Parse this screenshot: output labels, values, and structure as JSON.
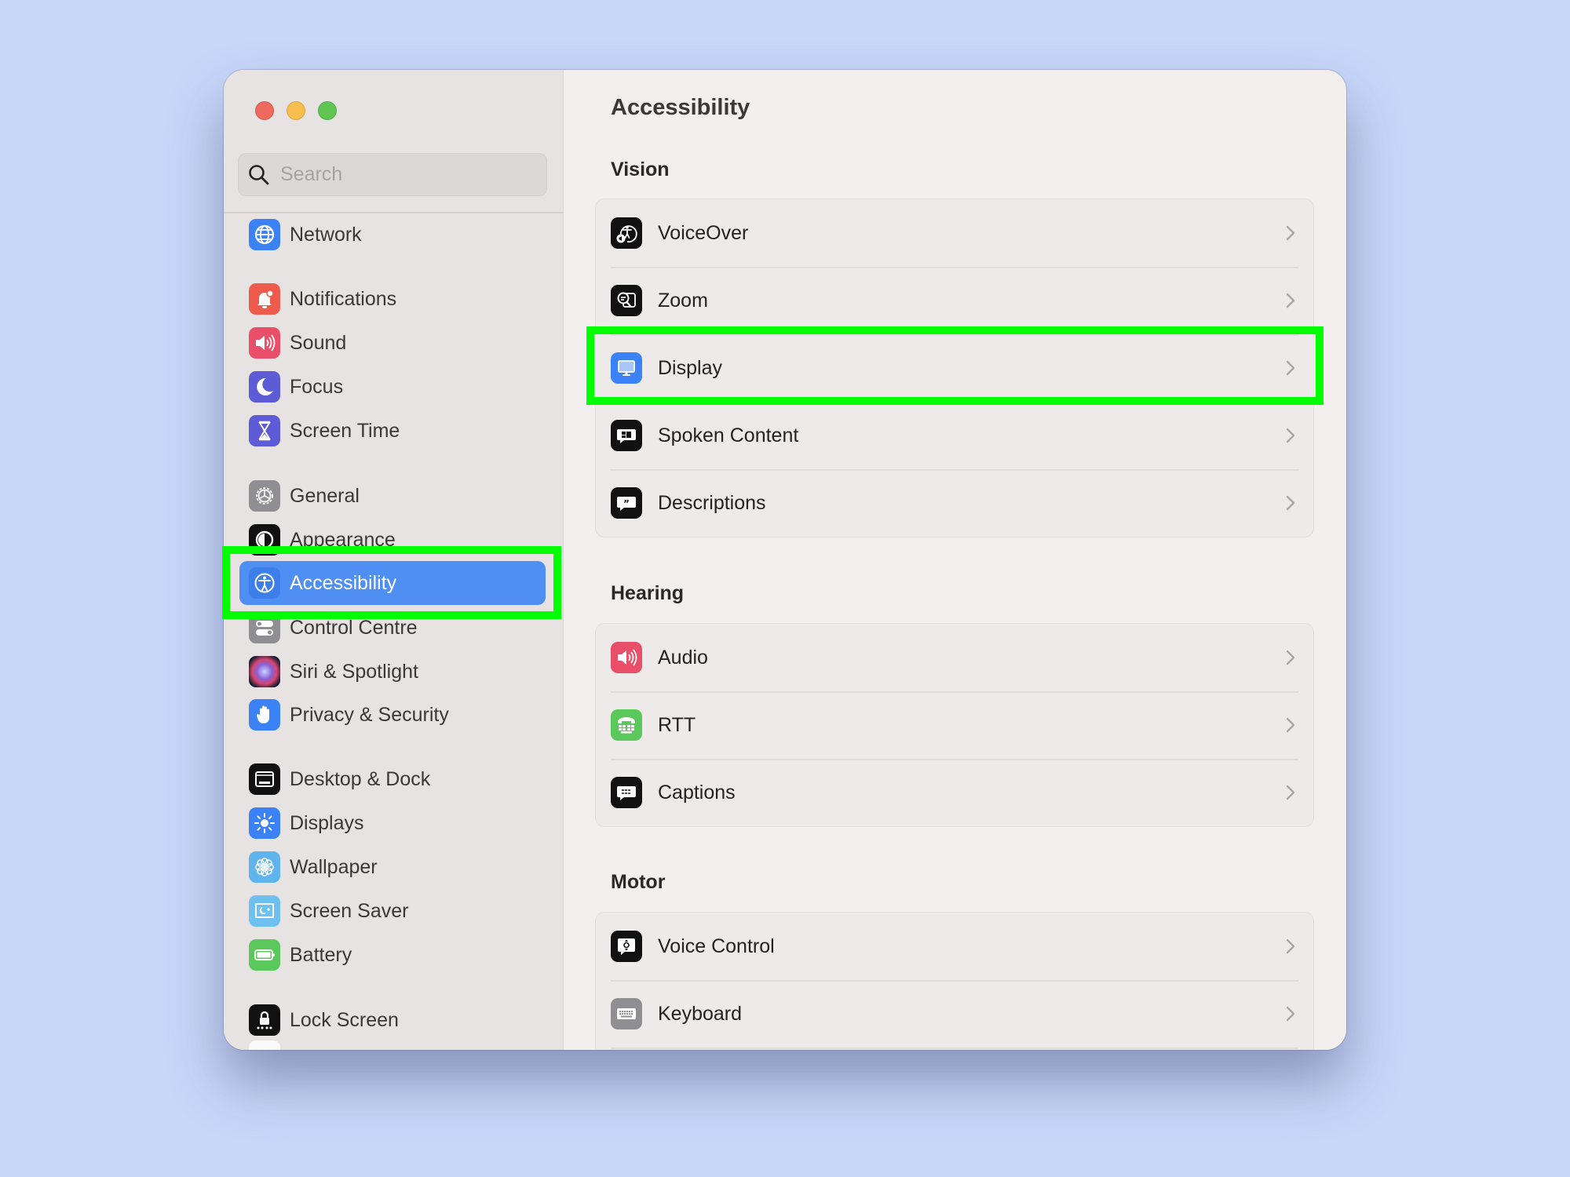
{
  "window": {
    "traffic_lights": {
      "close": "#ed6a5e",
      "minimize": "#f5be4f",
      "maximize": "#61c554"
    }
  },
  "sidebar": {
    "search": {
      "placeholder": "Search",
      "value": "",
      "icon": "search-icon"
    },
    "selected": "Accessibility",
    "accent": "#4f8ef2",
    "items": [
      {
        "label": "Network",
        "icon": "globe-icon",
        "color": "#3b82f6"
      },
      {
        "label": "Notifications",
        "icon": "bell-icon",
        "color": "#ee5b4d"
      },
      {
        "label": "Sound",
        "icon": "speaker-icon",
        "color": "#ea4f6a"
      },
      {
        "label": "Focus",
        "icon": "moon-icon",
        "color": "#5d5bd6"
      },
      {
        "label": "Screen Time",
        "icon": "hourglass-icon",
        "color": "#5d5bd6"
      },
      {
        "label": "General",
        "icon": "gear-icon",
        "color": "#8e8e93"
      },
      {
        "label": "Appearance",
        "icon": "appearance-icon",
        "color": "#111111"
      },
      {
        "label": "Accessibility",
        "icon": "accessibility-icon",
        "color": "#3d7fea"
      },
      {
        "label": "Control Centre",
        "icon": "toggles-icon",
        "color": "#8e8e93"
      },
      {
        "label": "Siri & Spotlight",
        "icon": "siri-icon",
        "color": "#2a2a4a"
      },
      {
        "label": "Privacy & Security",
        "icon": "hand-icon",
        "color": "#3b82f6"
      },
      {
        "label": "Desktop & Dock",
        "icon": "dock-icon",
        "color": "#111111"
      },
      {
        "label": "Displays",
        "icon": "sun-icon",
        "color": "#3b82f6"
      },
      {
        "label": "Wallpaper",
        "icon": "flower-icon",
        "color": "#5fb4ee"
      },
      {
        "label": "Screen Saver",
        "icon": "screensaver-icon",
        "color": "#6ec0f0"
      },
      {
        "label": "Battery",
        "icon": "battery-icon",
        "color": "#5ac85a"
      },
      {
        "label": "Lock Screen",
        "icon": "lock-icon",
        "color": "#111111"
      }
    ]
  },
  "content": {
    "title": "Accessibility",
    "sections": [
      {
        "heading": "Vision",
        "rows": [
          {
            "label": "VoiceOver",
            "icon": "voiceover-icon",
            "color": "#111111"
          },
          {
            "label": "Zoom",
            "icon": "zoom-magnifier-icon",
            "color": "#111111"
          },
          {
            "label": "Display",
            "icon": "monitor-icon",
            "color": "#3b82f6"
          },
          {
            "label": "Spoken Content",
            "icon": "spoken-content-icon",
            "color": "#111111"
          },
          {
            "label": "Descriptions",
            "icon": "quote-bubble-icon",
            "color": "#111111"
          }
        ]
      },
      {
        "heading": "Hearing",
        "rows": [
          {
            "label": "Audio",
            "icon": "speaker-icon",
            "color": "#ea4f6a"
          },
          {
            "label": "RTT",
            "icon": "tty-phone-icon",
            "color": "#5ac85a"
          },
          {
            "label": "Captions",
            "icon": "captions-bubble-icon",
            "color": "#111111"
          }
        ]
      },
      {
        "heading": "Motor",
        "rows": [
          {
            "label": "Voice Control",
            "icon": "voice-control-icon",
            "color": "#111111"
          },
          {
            "label": "Keyboard",
            "icon": "keyboard-icon",
            "color": "#8e8e93"
          }
        ]
      }
    ]
  },
  "annotations": {
    "highlight_color": "#00ff00",
    "highlighted": [
      "Accessibility",
      "Display"
    ]
  }
}
